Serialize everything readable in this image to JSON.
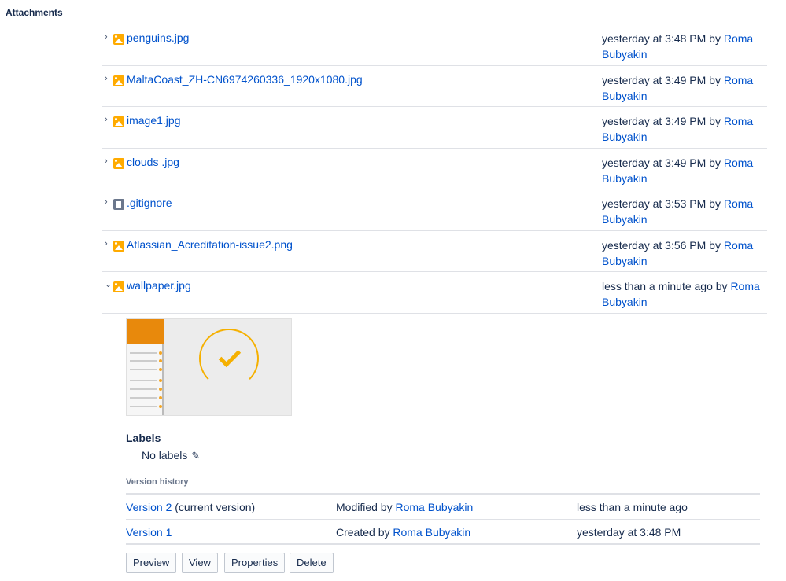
{
  "section_title": "Attachments",
  "attachments": [
    {
      "name": "penguins.jpg",
      "type": "image",
      "meta_prefix": "yesterday at 3:48 PM by ",
      "author_first": "Roma",
      "author_last": "Bubyakin",
      "chevron": "›"
    },
    {
      "name": "MaltaCoast_ZH-CN6974260336_1920x1080.jpg",
      "type": "image",
      "meta_prefix": "yesterday at 3:49 PM by ",
      "author_first": "Roma",
      "author_last": "Bubyakin",
      "chevron": "›"
    },
    {
      "name": "image1.jpg",
      "type": "image",
      "meta_prefix": "yesterday at 3:49 PM by ",
      "author_first": "Roma",
      "author_last": "Bubyakin",
      "chevron": "›"
    },
    {
      "name": "clouds .jpg",
      "type": "image",
      "meta_prefix": "yesterday at 3:49 PM by ",
      "author_first": "Roma",
      "author_last": "Bubyakin",
      "chevron": "›"
    },
    {
      "name": ".gitignore",
      "type": "document",
      "meta_prefix": "yesterday at 3:53 PM by ",
      "author_first": "Roma",
      "author_last": "Bubyakin",
      "chevron": "›"
    },
    {
      "name": "Atlassian_Acreditation-issue2.png",
      "type": "image",
      "meta_prefix": "yesterday at 3:56 PM by ",
      "author_first": "Roma",
      "author_last": "Bubyakin",
      "chevron": "›"
    },
    {
      "name": "wallpaper.jpg",
      "type": "image",
      "meta_prefix": "less than a minute ago by ",
      "author_first": "Roma",
      "author_last": "Bubyakin",
      "chevron": "⌄"
    }
  ],
  "expanded": {
    "labels_heading": "Labels",
    "labels_value": "No labels",
    "pencil_icon": "✎",
    "version_history_title": "Version history",
    "versions": [
      {
        "label": "Version 2",
        "suffix": " (current version)",
        "action": "Modified by ",
        "author": "Roma Bubyakin",
        "time": "less than a minute ago"
      },
      {
        "label": "Version 1",
        "suffix": "",
        "action": "Created by ",
        "author": "Roma Bubyakin",
        "time": "yesterday at 3:48 PM"
      }
    ],
    "buttons": {
      "preview": "Preview",
      "view": "View",
      "properties": "Properties",
      "delete": "Delete"
    }
  }
}
